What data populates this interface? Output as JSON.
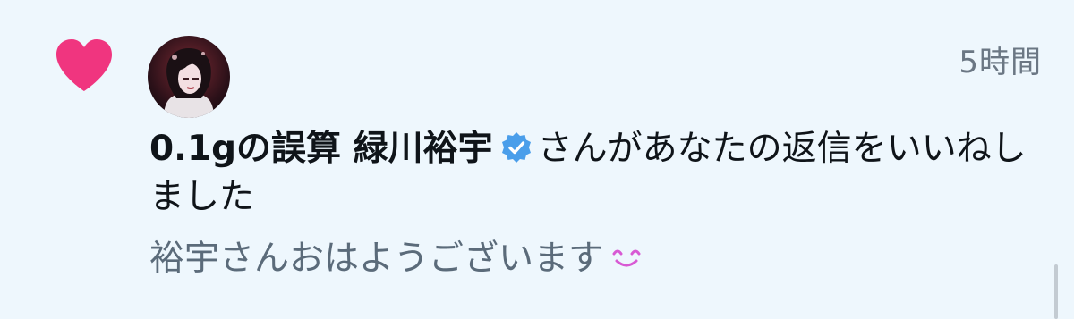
{
  "notification": {
    "icon": "heart-icon",
    "avatar_icon": "avatar",
    "timestamp": "5時間",
    "user_name": "0.1gの誤算 緑川裕宇",
    "verified_icon": "verified-badge-icon",
    "action_text": "さんがあなたの返信をいいねしました",
    "reply_text": "裕宇さんおはようございます",
    "reply_emoji_icon": "smiling-face-icon"
  },
  "colors": {
    "background": "#eef7fd",
    "heart": "#f0357f",
    "verified": "#4a9eea",
    "timestamp": "#6b7784",
    "reply_text": "#5b6b7a",
    "emoji": "#d85ad4"
  }
}
